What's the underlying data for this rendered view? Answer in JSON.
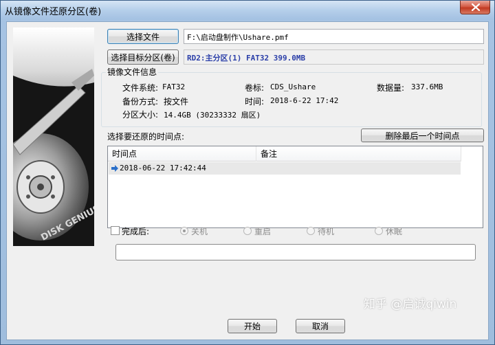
{
  "window": {
    "title": "从镜像文件还原分区(卷)"
  },
  "image_file": {
    "button_label": "选择文件",
    "path": "F:\\启动盘制作\\Ushare.pmf"
  },
  "target_partition": {
    "button_label": "选择目标分区(卷)",
    "value": "RD2:主分区(1) FAT32 399.0MB"
  },
  "image_info": {
    "group_label": "镜像文件信息",
    "filesystem_label": "文件系统:",
    "filesystem": "FAT32",
    "volume_label": "卷标:",
    "volume": "CDS_Ushare",
    "data_size_label": "数据量:",
    "data_size": "337.6MB",
    "backup_mode_label": "备份方式:",
    "backup_mode": "按文件",
    "time_label": "时间:",
    "time": "2018-6-22 17:42",
    "partition_size_label": "分区大小:",
    "partition_size": "14.4GB  (30233332 扇区)"
  },
  "timepoints": {
    "label": "选择要还原的时间点:",
    "delete_button": "删除最后一个时间点",
    "columns": [
      "时间点",
      "备注"
    ],
    "rows": [
      {
        "time": "2018-06-22 17:42:44",
        "note": ""
      }
    ]
  },
  "after_completion": {
    "checkbox_label": "完成后:",
    "options": [
      "关机",
      "重启",
      "待机",
      "休眠"
    ],
    "selected": "关机"
  },
  "buttons": {
    "start": "开始",
    "cancel": "取消"
  },
  "side_image": {
    "brand_text": "DISK GENIUS"
  },
  "watermark": "知乎 @启诚qiwin",
  "colors": {
    "target_text": "#2a3ea8",
    "close_button": "#c23a22"
  },
  "icons": {
    "close": "close-icon",
    "row_pointer": "arrow-right-icon"
  }
}
